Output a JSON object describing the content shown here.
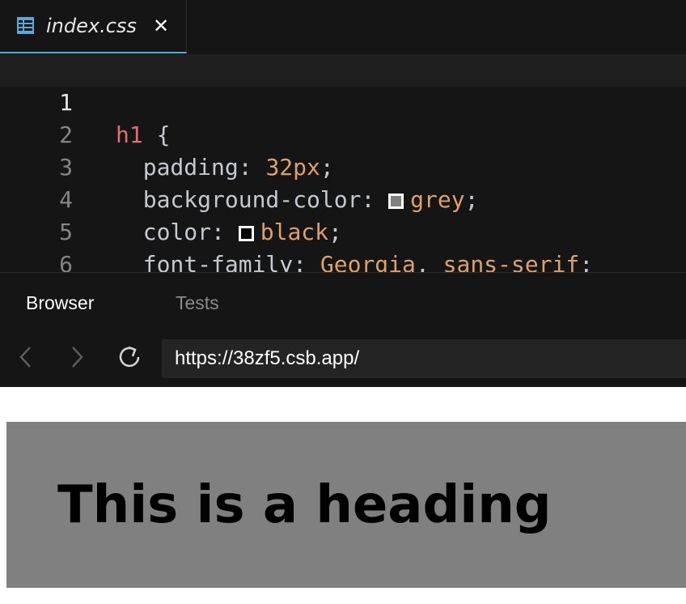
{
  "tab": {
    "filename": "index.css",
    "close_glyph": "✕",
    "icon": "css-file-icon"
  },
  "editor": {
    "line_numbers": [
      "1",
      "2",
      "3",
      "4",
      "5",
      "6"
    ],
    "lines": [
      {
        "selector": "h1",
        "open": " {"
      },
      {
        "prop": "padding",
        "value": "32px"
      },
      {
        "prop": "background-color",
        "value": "grey",
        "swatch": "#808080"
      },
      {
        "prop": "color",
        "value": "black",
        "swatch": "#000000"
      },
      {
        "prop": "font-family",
        "value1": "Georgia",
        "value2": "sans-serif"
      },
      {
        "close": "}"
      }
    ]
  },
  "panel": {
    "tabs": [
      {
        "label": "Browser",
        "active": true
      },
      {
        "label": "Tests",
        "active": false
      }
    ],
    "url": "https://38zf5.csb.app/"
  },
  "preview": {
    "heading": "This is a heading",
    "background": "#808080"
  },
  "colors": {
    "accent": "#5aa9d6",
    "selector": "#e06c75",
    "value": "#dca06f"
  }
}
